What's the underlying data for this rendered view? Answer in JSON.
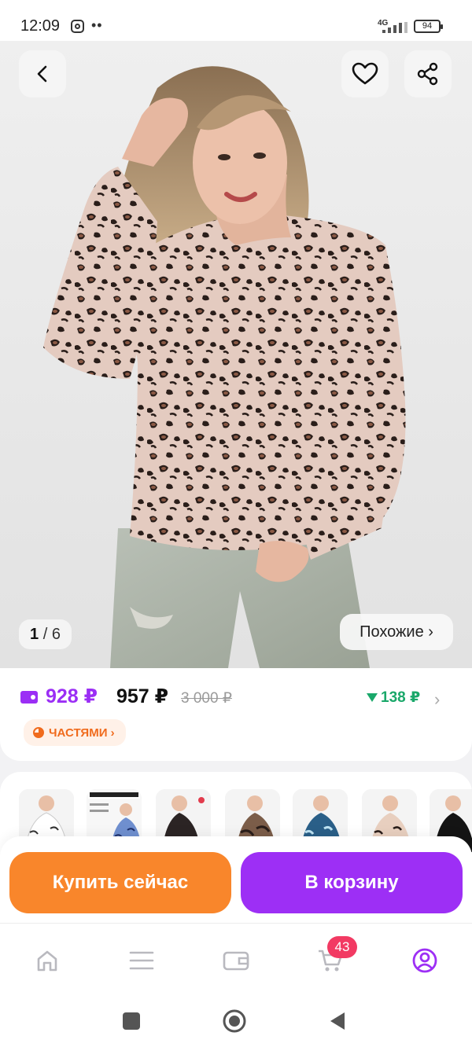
{
  "status_bar": {
    "time": "12:09",
    "network": "4G",
    "battery": "94"
  },
  "gallery": {
    "current": "1",
    "total": "6",
    "separator": "/",
    "similar_label": "Похожие ›"
  },
  "price": {
    "wallet_price": "928 ₽",
    "current_price": "957 ₽",
    "old_price": "3 000 ₽",
    "price_drop": "138 ₽",
    "installments_label": "ЧАСТЯМИ ›"
  },
  "actions": {
    "buy_now_label": "Купить сейчас",
    "add_to_cart_label": "В корзину"
  },
  "bottom_nav": {
    "cart_badge": "43"
  },
  "colors": {
    "accent_purple": "#9d2ff5",
    "accent_orange": "#f9862b",
    "price_drop_green": "#1aa86a",
    "badge_red": "#f23a63"
  }
}
